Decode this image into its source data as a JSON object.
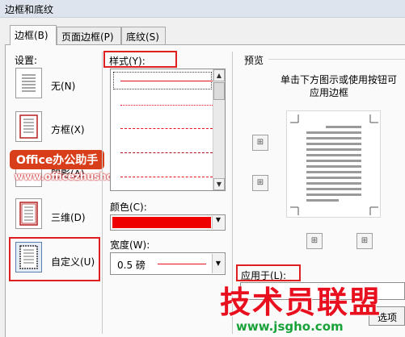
{
  "window": {
    "title": "边框和底纹"
  },
  "tabs": [
    {
      "label": "边框(B)"
    },
    {
      "label": "页面边框(P)"
    },
    {
      "label": "底纹(S)"
    }
  ],
  "settings": {
    "label": "设置:",
    "options": [
      {
        "label": "无(N)"
      },
      {
        "label": "方框(X)"
      },
      {
        "label": "阴影(A)"
      },
      {
        "label": "三维(D)"
      },
      {
        "label": "自定义(U)",
        "selected": true
      }
    ]
  },
  "style": {
    "label": "样式(Y):",
    "lines": [
      "solid",
      "dotted",
      "dashed",
      "dash-small",
      "dash-dot"
    ],
    "color": "#e8101e"
  },
  "color": {
    "label": "颜色(C):",
    "value": "#ee0000"
  },
  "width": {
    "label": "宽度(W):",
    "value": "0.5 磅"
  },
  "preview": {
    "label": "预览",
    "hint_line1": "单击下方图示或使用按钮可",
    "hint_line2": "应用边框"
  },
  "apply_to": {
    "label": "应用于(L):"
  },
  "options_button": {
    "label": "选项"
  },
  "overlay": {
    "badge_text": "Office办公助手",
    "badge_url": "www.officezhushou.com",
    "watermark_text": "技术员联盟",
    "watermark_url": "www.jsgho.com"
  }
}
